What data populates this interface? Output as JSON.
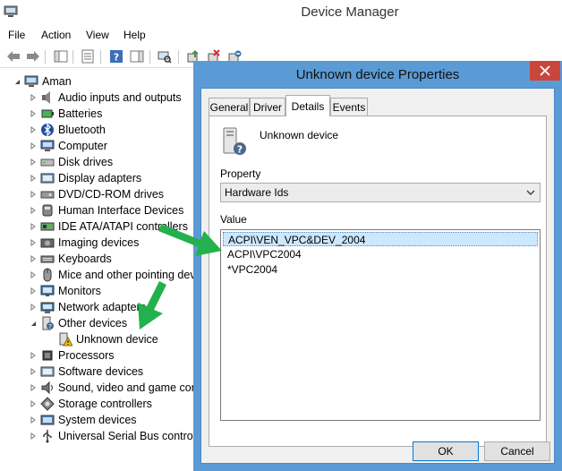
{
  "window": {
    "title": "Device Manager",
    "icon": "device-manager-icon"
  },
  "menu": [
    "File",
    "Action",
    "View",
    "Help"
  ],
  "toolbar": {
    "icons": [
      "back-arrow-icon",
      "forward-arrow-icon",
      "console-tree-icon",
      "properties-icon",
      "help-icon",
      "action-pane-icon",
      "scan-hardware-icon",
      "update-driver-icon",
      "uninstall-icon",
      "disable-device-icon"
    ]
  },
  "tree": {
    "root": "Aman",
    "items": [
      {
        "label": "Audio inputs and outputs",
        "icon": "speaker-icon"
      },
      {
        "label": "Batteries",
        "icon": "battery-icon"
      },
      {
        "label": "Bluetooth",
        "icon": "bluetooth-icon"
      },
      {
        "label": "Computer",
        "icon": "computer-icon"
      },
      {
        "label": "Disk drives",
        "icon": "disk-drive-icon"
      },
      {
        "label": "Display adapters",
        "icon": "display-adapter-icon"
      },
      {
        "label": "DVD/CD-ROM drives",
        "icon": "dvd-icon"
      },
      {
        "label": "Human Interface Devices",
        "icon": "hid-icon"
      },
      {
        "label": "IDE ATA/ATAPI controllers",
        "icon": "ide-controller-icon"
      },
      {
        "label": "Imaging devices",
        "icon": "camera-icon"
      },
      {
        "label": "Keyboards",
        "icon": "keyboard-icon"
      },
      {
        "label": "Mice and other pointing devices",
        "icon": "mouse-icon"
      },
      {
        "label": "Monitors",
        "icon": "monitor-icon"
      },
      {
        "label": "Network adapters",
        "icon": "network-adapter-icon"
      },
      {
        "label": "Other devices",
        "icon": "other-devices-icon",
        "expanded": true
      },
      {
        "label": "Unknown device",
        "icon": "unknown-device-warning-icon",
        "child": true
      },
      {
        "label": "Processors",
        "icon": "processor-icon"
      },
      {
        "label": "Software devices",
        "icon": "software-device-icon"
      },
      {
        "label": "Sound, video and game controllers",
        "icon": "sound-icon"
      },
      {
        "label": "Storage controllers",
        "icon": "storage-controller-icon"
      },
      {
        "label": "System devices",
        "icon": "system-device-icon"
      },
      {
        "label": "Universal Serial Bus controllers",
        "icon": "usb-icon"
      }
    ]
  },
  "dialog": {
    "title": "Unknown device Properties",
    "tabs": [
      "General",
      "Driver",
      "Details",
      "Events"
    ],
    "active_tab": "Details",
    "device_name": "Unknown device",
    "property_label": "Property",
    "property_value": "Hardware Ids",
    "value_label": "Value",
    "values": [
      "ACPI\\VEN_VPC&DEV_2004",
      "ACPI\\VPC2004",
      "*VPC2004"
    ],
    "ok_label": "OK",
    "cancel_label": "Cancel"
  },
  "colors": {
    "dialog_frame": "#5b9bd5",
    "close_button": "#c9463d",
    "selection": "#cce8ff",
    "annotation_arrow": "#22b14c"
  }
}
